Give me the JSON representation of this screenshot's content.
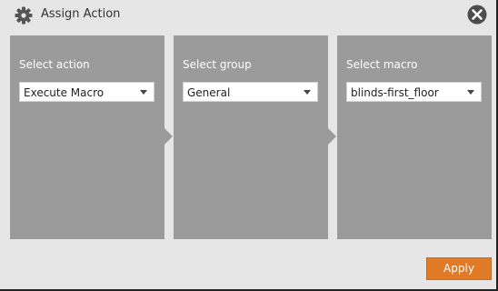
{
  "dialog": {
    "title": "Assign Action",
    "icons": {
      "header": "gear-icon",
      "close": "close-icon",
      "dropdown": "chevron-down-icon"
    }
  },
  "panels": [
    {
      "label": "Select action",
      "selected": "Execute Macro"
    },
    {
      "label": "Select group",
      "selected": "General"
    },
    {
      "label": "Select macro",
      "selected": "blinds-first_floor"
    }
  ],
  "footer": {
    "apply_label": "Apply"
  },
  "colors": {
    "background": "#e6e6e6",
    "panel": "#9b9b9b",
    "accent": "#e07a27",
    "close_icon": "#4d4d4d"
  }
}
